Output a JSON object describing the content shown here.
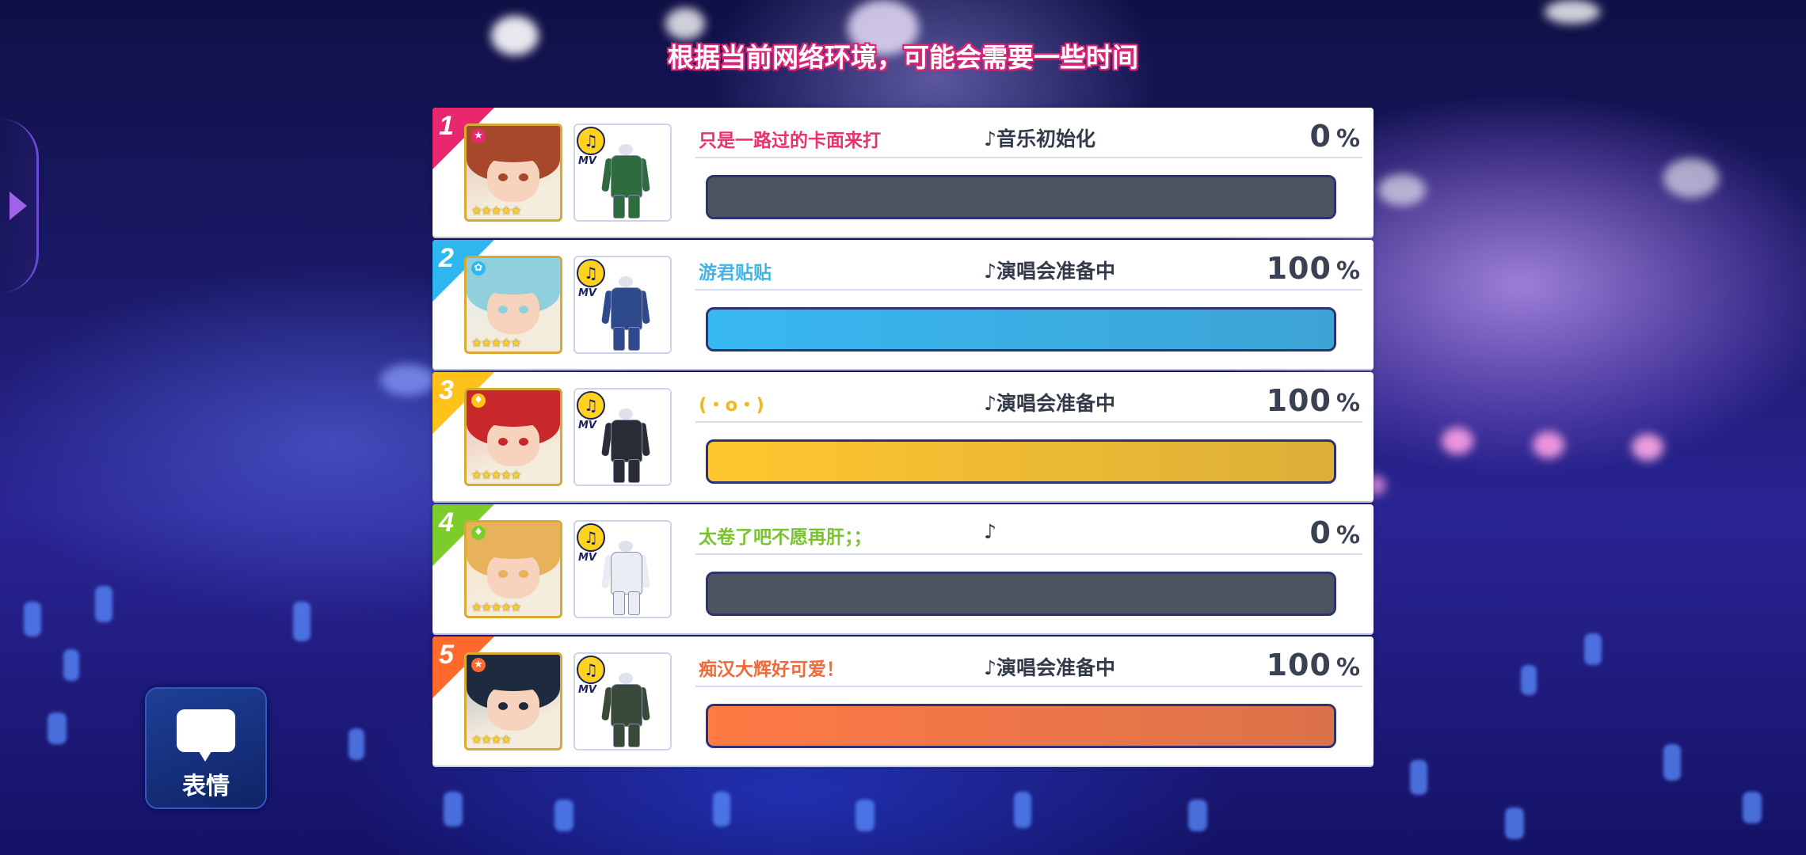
{
  "header": {
    "notice": "根据当前网络环境，可能会需要一些时间"
  },
  "emote_button": {
    "label": "表情"
  },
  "colors": {
    "rank1": "#e8276f",
    "rank2": "#2fb8f0",
    "rank3": "#ffc21a",
    "rank4": "#7ccc2c",
    "rank5": "#ff6a2c",
    "bar_empty": "#4e5360",
    "bar_blue": "#38b8f2",
    "bar_yellow": "#ffc62e",
    "bar_orange": "#ff7a45"
  },
  "players": [
    {
      "rank": "1",
      "name": "只是一路过的卡面来打",
      "status": "♪音乐初始化",
      "percent_value": "0",
      "percent_sign": "%",
      "progress": 0,
      "stars": "★★★★★",
      "mv": "MV",
      "attr_icon": "star-icon",
      "rank_color": "#e8276f",
      "name_color": "#e8336b",
      "bar_color": "#4e5360",
      "hair_color": "#a8482a",
      "outfit_color": "#2e6b3f"
    },
    {
      "rank": "2",
      "name": "游君贴贴",
      "status": "♪演唱会准备中",
      "percent_value": "100",
      "percent_sign": "%",
      "progress": 100,
      "stars": "★★★★★",
      "mv": "MV",
      "attr_icon": "leaf-icon",
      "rank_color": "#2fb8f0",
      "name_color": "#3eb4e8",
      "bar_color": "#38b8f2",
      "hair_color": "#8fd0dc",
      "outfit_color": "#2f4a8c"
    },
    {
      "rank": "3",
      "name": "(・o・)",
      "status": "♪演唱会准备中",
      "percent_value": "100",
      "percent_sign": "%",
      "progress": 100,
      "stars": "★★★★★",
      "mv": "MV",
      "attr_icon": "drop-icon",
      "rank_color": "#ffc21a",
      "name_color": "#f2b822",
      "bar_color": "#ffc62e",
      "hair_color": "#c8282a",
      "outfit_color": "#2a2c36"
    },
    {
      "rank": "4",
      "name": "太卷了吧不愿再肝；；",
      "status": "♪",
      "percent_value": "0",
      "percent_sign": "%",
      "progress": 0,
      "stars": "★★★★★",
      "mv": "MV",
      "attr_icon": "drop-icon",
      "rank_color": "#7ccc2c",
      "name_color": "#7ac232",
      "bar_color": "#4e5360",
      "hair_color": "#e8b25a",
      "outfit_color": "#e9ecf2"
    },
    {
      "rank": "5",
      "name": "痴汉大辉好可爱！",
      "status": "♪演唱会准备中",
      "percent_value": "100",
      "percent_sign": "%",
      "progress": 100,
      "stars": "★★★★",
      "mv": "MV",
      "attr_icon": "star-icon",
      "rank_color": "#ff6a2c",
      "name_color": "#f06a3a",
      "bar_color": "#ff7a45",
      "hair_color": "#1e2a3e",
      "outfit_color": "#3a4a3a"
    }
  ]
}
